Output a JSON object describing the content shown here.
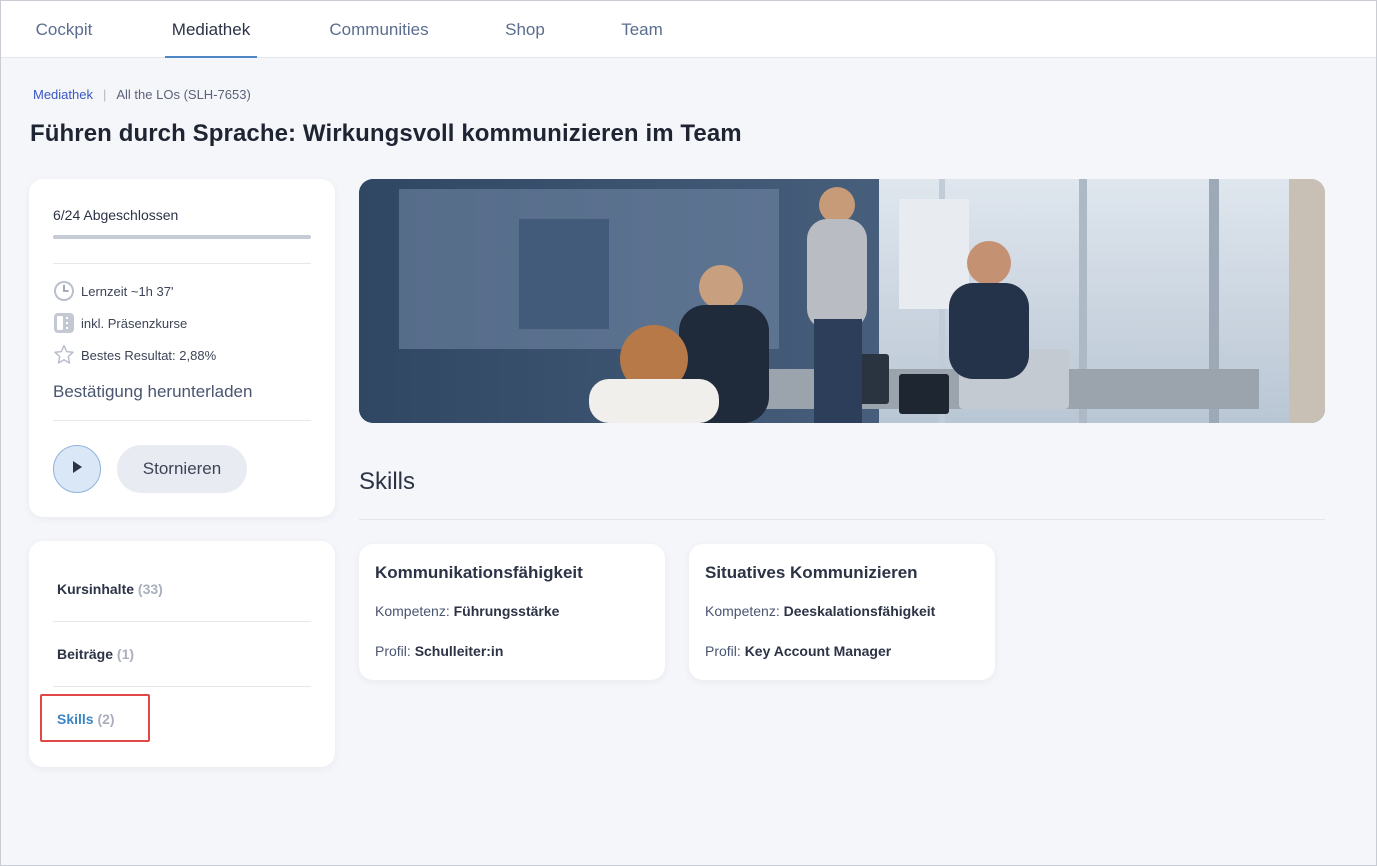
{
  "nav": {
    "tabs": [
      {
        "label": "Cockpit"
      },
      {
        "label": "Mediathek"
      },
      {
        "label": "Communities"
      },
      {
        "label": "Shop"
      },
      {
        "label": "Team"
      }
    ]
  },
  "breadcrumb": {
    "root": "Mediathek",
    "separator": "|",
    "current": "All the LOs (SLH-7653)"
  },
  "page_title": "Führen durch Sprache: Wirkungsvoll kommunizieren im Team",
  "progress": {
    "label": "6/24 Abgeschlossen",
    "fraction": 0.0,
    "learning_time": "Lernzeit ~1h 37'",
    "classroom": "inkl. Präsenzkurse",
    "best_result": "Bestes Resultat: 2,88%",
    "download_label": "Bestätigung herunterladen",
    "cancel_label": "Stornieren",
    "icons": [
      "clock-icon",
      "classroom-icon",
      "star-icon",
      "play-icon"
    ]
  },
  "side_menu": {
    "items": [
      {
        "label": "Kursinhalte",
        "count": "(33)"
      },
      {
        "label": "Beiträge",
        "count": "(1)"
      },
      {
        "label": "Skills",
        "count": "(2)"
      }
    ]
  },
  "skills": {
    "title": "Skills",
    "cards": [
      {
        "title": "Kommunikationsfähigkeit",
        "competence_label": "Kompetenz:",
        "competence_value": "Führungsstärke",
        "profile_label": "Profil:",
        "profile_value": "Schulleiter:in"
      },
      {
        "title": "Situatives Kommunizieren",
        "competence_label": "Kompetenz:",
        "competence_value": "Deeskalationsfähigkeit",
        "profile_label": "Profil:",
        "profile_value": "Key Account Manager"
      }
    ]
  },
  "colors": {
    "accent": "#3b86c6",
    "highlight": "#e04848",
    "background": "#f5f6fa"
  }
}
